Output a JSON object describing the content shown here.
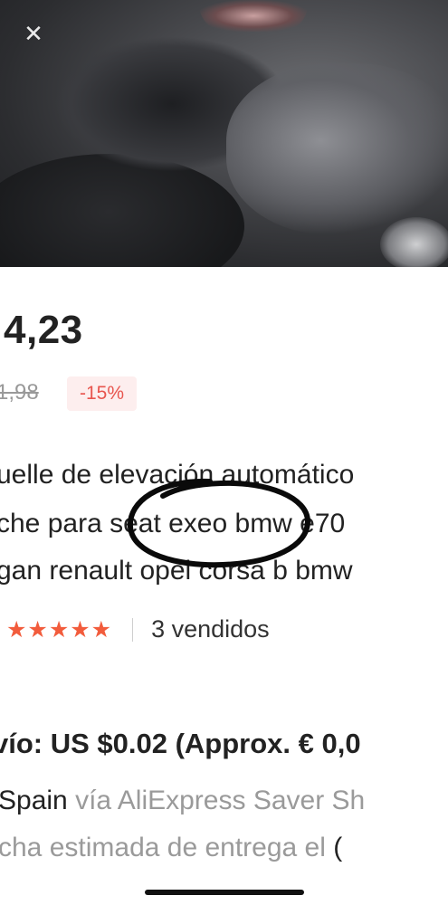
{
  "hero": {
    "close_icon": "close-icon",
    "close_glyph": "✕"
  },
  "product": {
    "price": "4,23",
    "old_price": "1,98",
    "discount": "-15%",
    "title_lines": [
      "uelle de elevación automático",
      "che para seat exeo bmw e70",
      "gan renault opel corsa b bmw"
    ],
    "rating": {
      "lead": ")",
      "stars": "★★★★★",
      "sold": "3 vendidos"
    }
  },
  "shipping": {
    "cost": "vío: US $0.02 (Approx. € 0,0",
    "country": "Spain",
    "via": " vía AliExpress Saver Sh",
    "delivery": "cha estimada de entrega el",
    "delivery_tail": " ("
  },
  "colors": {
    "accent": "#f25c3c",
    "discount_bg": "#fdeeee",
    "discount_text": "#e8554e",
    "muted": "#9a9a9a"
  }
}
